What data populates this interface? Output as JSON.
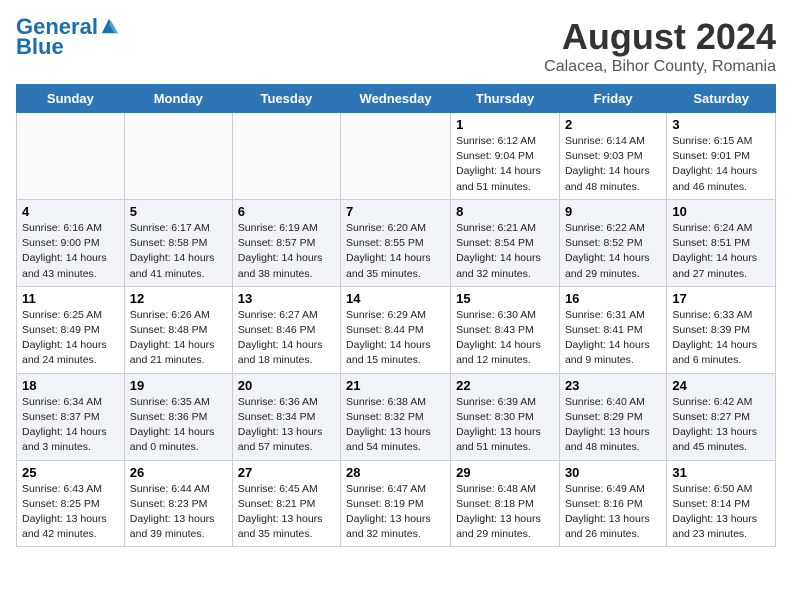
{
  "logo": {
    "line1": "General",
    "line2": "Blue"
  },
  "title": "August 2024",
  "location": "Calacea, Bihor County, Romania",
  "days_of_week": [
    "Sunday",
    "Monday",
    "Tuesday",
    "Wednesday",
    "Thursday",
    "Friday",
    "Saturday"
  ],
  "weeks": [
    [
      {
        "day": "",
        "info": ""
      },
      {
        "day": "",
        "info": ""
      },
      {
        "day": "",
        "info": ""
      },
      {
        "day": "",
        "info": ""
      },
      {
        "day": "1",
        "info": "Sunrise: 6:12 AM\nSunset: 9:04 PM\nDaylight: 14 hours and 51 minutes."
      },
      {
        "day": "2",
        "info": "Sunrise: 6:14 AM\nSunset: 9:03 PM\nDaylight: 14 hours and 48 minutes."
      },
      {
        "day": "3",
        "info": "Sunrise: 6:15 AM\nSunset: 9:01 PM\nDaylight: 14 hours and 46 minutes."
      }
    ],
    [
      {
        "day": "4",
        "info": "Sunrise: 6:16 AM\nSunset: 9:00 PM\nDaylight: 14 hours and 43 minutes."
      },
      {
        "day": "5",
        "info": "Sunrise: 6:17 AM\nSunset: 8:58 PM\nDaylight: 14 hours and 41 minutes."
      },
      {
        "day": "6",
        "info": "Sunrise: 6:19 AM\nSunset: 8:57 PM\nDaylight: 14 hours and 38 minutes."
      },
      {
        "day": "7",
        "info": "Sunrise: 6:20 AM\nSunset: 8:55 PM\nDaylight: 14 hours and 35 minutes."
      },
      {
        "day": "8",
        "info": "Sunrise: 6:21 AM\nSunset: 8:54 PM\nDaylight: 14 hours and 32 minutes."
      },
      {
        "day": "9",
        "info": "Sunrise: 6:22 AM\nSunset: 8:52 PM\nDaylight: 14 hours and 29 minutes."
      },
      {
        "day": "10",
        "info": "Sunrise: 6:24 AM\nSunset: 8:51 PM\nDaylight: 14 hours and 27 minutes."
      }
    ],
    [
      {
        "day": "11",
        "info": "Sunrise: 6:25 AM\nSunset: 8:49 PM\nDaylight: 14 hours and 24 minutes."
      },
      {
        "day": "12",
        "info": "Sunrise: 6:26 AM\nSunset: 8:48 PM\nDaylight: 14 hours and 21 minutes."
      },
      {
        "day": "13",
        "info": "Sunrise: 6:27 AM\nSunset: 8:46 PM\nDaylight: 14 hours and 18 minutes."
      },
      {
        "day": "14",
        "info": "Sunrise: 6:29 AM\nSunset: 8:44 PM\nDaylight: 14 hours and 15 minutes."
      },
      {
        "day": "15",
        "info": "Sunrise: 6:30 AM\nSunset: 8:43 PM\nDaylight: 14 hours and 12 minutes."
      },
      {
        "day": "16",
        "info": "Sunrise: 6:31 AM\nSunset: 8:41 PM\nDaylight: 14 hours and 9 minutes."
      },
      {
        "day": "17",
        "info": "Sunrise: 6:33 AM\nSunset: 8:39 PM\nDaylight: 14 hours and 6 minutes."
      }
    ],
    [
      {
        "day": "18",
        "info": "Sunrise: 6:34 AM\nSunset: 8:37 PM\nDaylight: 14 hours and 3 minutes."
      },
      {
        "day": "19",
        "info": "Sunrise: 6:35 AM\nSunset: 8:36 PM\nDaylight: 14 hours and 0 minutes."
      },
      {
        "day": "20",
        "info": "Sunrise: 6:36 AM\nSunset: 8:34 PM\nDaylight: 13 hours and 57 minutes."
      },
      {
        "day": "21",
        "info": "Sunrise: 6:38 AM\nSunset: 8:32 PM\nDaylight: 13 hours and 54 minutes."
      },
      {
        "day": "22",
        "info": "Sunrise: 6:39 AM\nSunset: 8:30 PM\nDaylight: 13 hours and 51 minutes."
      },
      {
        "day": "23",
        "info": "Sunrise: 6:40 AM\nSunset: 8:29 PM\nDaylight: 13 hours and 48 minutes."
      },
      {
        "day": "24",
        "info": "Sunrise: 6:42 AM\nSunset: 8:27 PM\nDaylight: 13 hours and 45 minutes."
      }
    ],
    [
      {
        "day": "25",
        "info": "Sunrise: 6:43 AM\nSunset: 8:25 PM\nDaylight: 13 hours and 42 minutes."
      },
      {
        "day": "26",
        "info": "Sunrise: 6:44 AM\nSunset: 8:23 PM\nDaylight: 13 hours and 39 minutes."
      },
      {
        "day": "27",
        "info": "Sunrise: 6:45 AM\nSunset: 8:21 PM\nDaylight: 13 hours and 35 minutes."
      },
      {
        "day": "28",
        "info": "Sunrise: 6:47 AM\nSunset: 8:19 PM\nDaylight: 13 hours and 32 minutes."
      },
      {
        "day": "29",
        "info": "Sunrise: 6:48 AM\nSunset: 8:18 PM\nDaylight: 13 hours and 29 minutes."
      },
      {
        "day": "30",
        "info": "Sunrise: 6:49 AM\nSunset: 8:16 PM\nDaylight: 13 hours and 26 minutes."
      },
      {
        "day": "31",
        "info": "Sunrise: 6:50 AM\nSunset: 8:14 PM\nDaylight: 13 hours and 23 minutes."
      }
    ]
  ]
}
